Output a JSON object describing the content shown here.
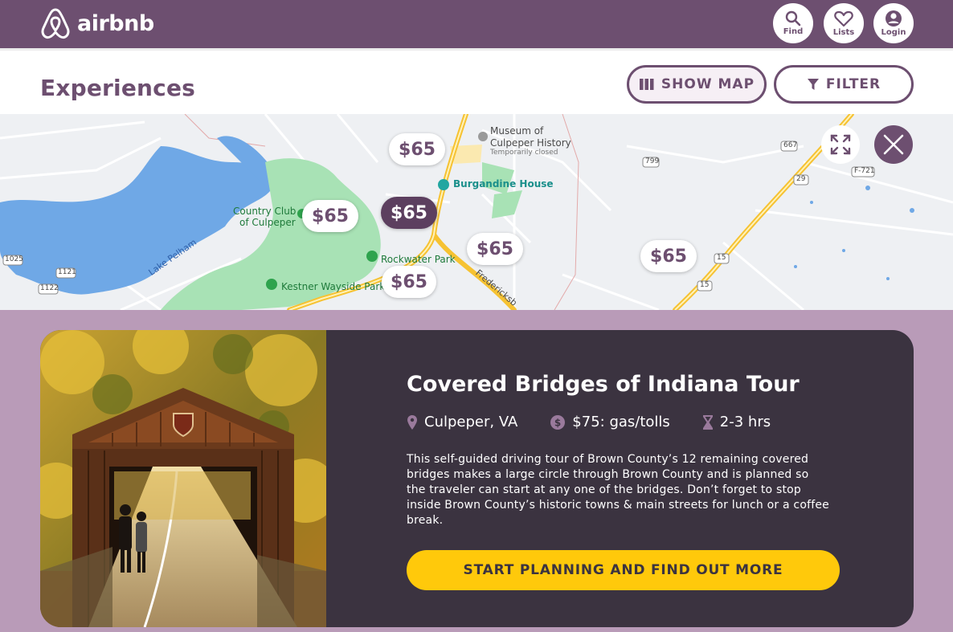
{
  "app": {
    "brand": "airbnb"
  },
  "nav": {
    "find_label": "Find",
    "lists_label": "Lists",
    "login_label": "Login"
  },
  "header": {
    "title": "Experiences",
    "show_map_label": "SHOW MAP",
    "filter_label": "FILTER"
  },
  "map": {
    "pins": [
      "$65",
      "$65",
      "$65",
      "$65",
      "$65",
      "$65"
    ],
    "active_pin_index": 1,
    "labels": {
      "museum": "Museum of",
      "museum2": "Culpeper History",
      "museum3": "Temporarily closed",
      "burgandine": "Burgandine House",
      "country_club": "Country Club",
      "country_club2": "of Culpeper",
      "lake": "Lake Pelham",
      "rockwater": "Rockwater Park",
      "kestner": "Kestner Wayside Park",
      "fredericksburg": "Fredericksb",
      "r1025": "1025",
      "r1121": "1121",
      "r1122": "1122",
      "r667": "667",
      "r799": "799",
      "r29": "29",
      "rF721": "F-721",
      "r15a": "15",
      "r15b": "15"
    }
  },
  "card": {
    "title": "Covered Bridges of Indiana Tour",
    "location": "Culpeper, VA",
    "cost": "$75: gas/tolls",
    "duration": "2-3 hrs",
    "description": "This self-guided driving tour of Brown County’s 12 remaining covered bridges makes a large circle through Brown County and is planned so the traveler can start at any one of the bridges. Don’t forget to stop inside Brown County’s historic towns & main streets for lunch or a coffee break.",
    "cta_label": "START PLANNING AND FIND OUT MORE"
  },
  "colors": {
    "brand_purple": "#6d4f70",
    "card_bg": "#3b3340",
    "section_bg": "#b99bb8",
    "cta_yellow": "#ffc90b"
  }
}
